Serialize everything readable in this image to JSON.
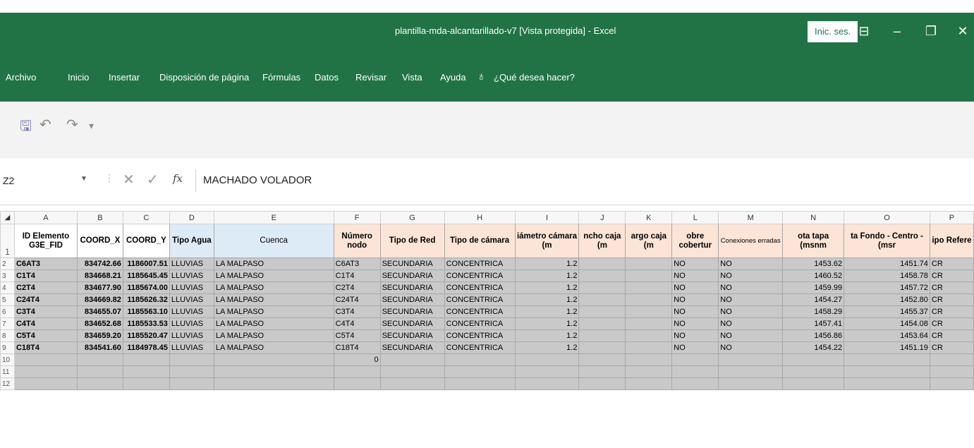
{
  "window": {
    "title": "plantilla-mda-alcantarillado-v7  [Vista protegida]  -  Excel",
    "signin_label": "Inic. ses."
  },
  "ribbon": {
    "tabs": [
      "Archivo",
      "Inicio",
      "Insertar",
      "Disposición de página",
      "Fórmulas",
      "Datos",
      "Revisar",
      "Vista",
      "Ayuda"
    ],
    "tell_me": "¿Qué desea hacer?"
  },
  "formula_bar": {
    "name_box": "Z2",
    "fx": "fx",
    "value": "MACHADO VOLADOR"
  },
  "sheet": {
    "columns": [
      "A",
      "B",
      "C",
      "D",
      "E",
      "F",
      "G",
      "H",
      "I",
      "J",
      "K",
      "L",
      "M",
      "N",
      "O",
      "P"
    ],
    "headers": [
      "ID Elemento G3E_FID",
      "COORD_X",
      "COORD_Y",
      "Tipo Agua",
      "Cuenca",
      "Número nodo",
      "Tipo de Red",
      "Tipo de cámara",
      "iámetro cámara (m",
      "ncho caja (m",
      "argo caja (m",
      "obre cobertur",
      "Conexiones erradas",
      "ota tapa (msnm",
      "ta Fondo - Centro - (msr",
      "ipo Refere"
    ],
    "rows": [
      {
        "n": "2",
        "cells": [
          "C6AT3",
          "834742.66",
          "1186007.51",
          "LLUVIAS",
          "LA MALPASO",
          "C6AT3",
          "SECUNDARIA",
          "CONCENTRICA",
          "1.2",
          "",
          "",
          "NO",
          "NO",
          "1453.62",
          "1451.74",
          "CR"
        ]
      },
      {
        "n": "3",
        "cells": [
          "C1T4",
          "834668.21",
          "1185645.45",
          "LLUVIAS",
          "LA MALPASO",
          "C1T4",
          "SECUNDARIA",
          "CONCENTRICA",
          "1.2",
          "",
          "",
          "NO",
          "NO",
          "1460.52",
          "1458.78",
          "CR"
        ]
      },
      {
        "n": "4",
        "cells": [
          "C2T4",
          "834677.90",
          "1185674.00",
          "LLUVIAS",
          "LA MALPASO",
          "C2T4",
          "SECUNDARIA",
          "CONCENTRICA",
          "1.2",
          "",
          "",
          "NO",
          "NO",
          "1459.99",
          "1457.72",
          "CR"
        ]
      },
      {
        "n": "5",
        "cells": [
          "C24T4",
          "834669.82",
          "1185626.32",
          "LLUVIAS",
          "LA MALPASO",
          "C24T4",
          "SECUNDARIA",
          "CONCENTRICA",
          "1.2",
          "",
          "",
          "NO",
          "NO",
          "1454.27",
          "1452.80",
          "CR"
        ]
      },
      {
        "n": "6",
        "cells": [
          "C3T4",
          "834655.07",
          "1185563.10",
          "LLUVIAS",
          "LA MALPASO",
          "C3T4",
          "SECUNDARIA",
          "CONCENTRICA",
          "1.2",
          "",
          "",
          "NO",
          "NO",
          "1458.29",
          "1455.37",
          "CR"
        ]
      },
      {
        "n": "7",
        "cells": [
          "C4T4",
          "834652.68",
          "1185533.53",
          "LLUVIAS",
          "LA MALPASO",
          "C4T4",
          "SECUNDARIA",
          "CONCENTRICA",
          "1.2",
          "",
          "",
          "NO",
          "NO",
          "1457.41",
          "1454.08",
          "CR"
        ]
      },
      {
        "n": "8",
        "cells": [
          "C5T4",
          "834659.20",
          "1185520.47",
          "LLUVIAS",
          "LA MALPASO",
          "C5T4",
          "SECUNDARIA",
          "CONCENTRICA",
          "1.2",
          "",
          "",
          "NO",
          "NO",
          "1456.86",
          "1453.64",
          "CR"
        ]
      },
      {
        "n": "9",
        "cells": [
          "C18T4",
          "834541.60",
          "1184978.45",
          "LLUVIAS",
          "LA MALPASO",
          "C18T4",
          "SECUNDARIA",
          "CONCENTRICA",
          "1.2",
          "",
          "",
          "NO",
          "NO",
          "1454.22",
          "1451.19",
          "CR"
        ]
      },
      {
        "n": "10",
        "cells": [
          "",
          "",
          "",
          "",
          "",
          "0",
          "",
          "",
          "",
          "",
          "",
          "",
          "",
          "",
          "",
          ""
        ]
      },
      {
        "n": "11",
        "cells": [
          "",
          "",
          "",
          "",
          "",
          "",
          "",
          "",
          "",
          "",
          "",
          "",
          "",
          "",
          "",
          ""
        ]
      },
      {
        "n": "12",
        "cells": [
          "",
          "",
          "",
          "",
          "",
          "",
          "",
          "",
          "",
          "",
          "",
          "",
          "",
          "",
          "",
          ""
        ]
      }
    ]
  },
  "colors": {
    "excel_green": "#217346",
    "header_blue": "#ddebf7",
    "header_peach": "#fce4d6",
    "data_gray": "#c9c9c9"
  }
}
